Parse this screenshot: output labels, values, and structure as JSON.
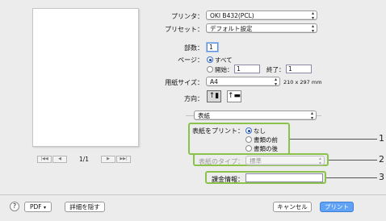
{
  "printer": {
    "label": "プリンタ：",
    "value": "OKI B432(PCL)"
  },
  "preset": {
    "label": "プリセット：",
    "value": "デフォルト設定"
  },
  "copies": {
    "label": "部数：",
    "value": "1"
  },
  "pages": {
    "label": "ページ：",
    "all_label": "すべて",
    "from_label": "開始：",
    "from_value": "1",
    "to_label": "終了：",
    "to_value": "1"
  },
  "paper_size": {
    "label": "用紙サイズ：",
    "value": "A4",
    "dimensions": "210 x 297 mm"
  },
  "orientation": {
    "label": "方向："
  },
  "section_popup": {
    "value": "表紙"
  },
  "cover_page": {
    "label": "表紙をプリント：",
    "options": [
      "なし",
      "書類の前",
      "書類の後"
    ]
  },
  "cover_type": {
    "label": "表紙のタイプ：",
    "value": "標準"
  },
  "billing": {
    "label": "課金情報：",
    "value": ""
  },
  "preview_nav": {
    "page_indicator": "1/1"
  },
  "bottom": {
    "help": "?",
    "pdf_label": "PDF",
    "hide_details": "詳細を隠す",
    "cancel": "キャンセル",
    "print": "プリント"
  },
  "callouts": [
    "1",
    "2",
    "3"
  ]
}
